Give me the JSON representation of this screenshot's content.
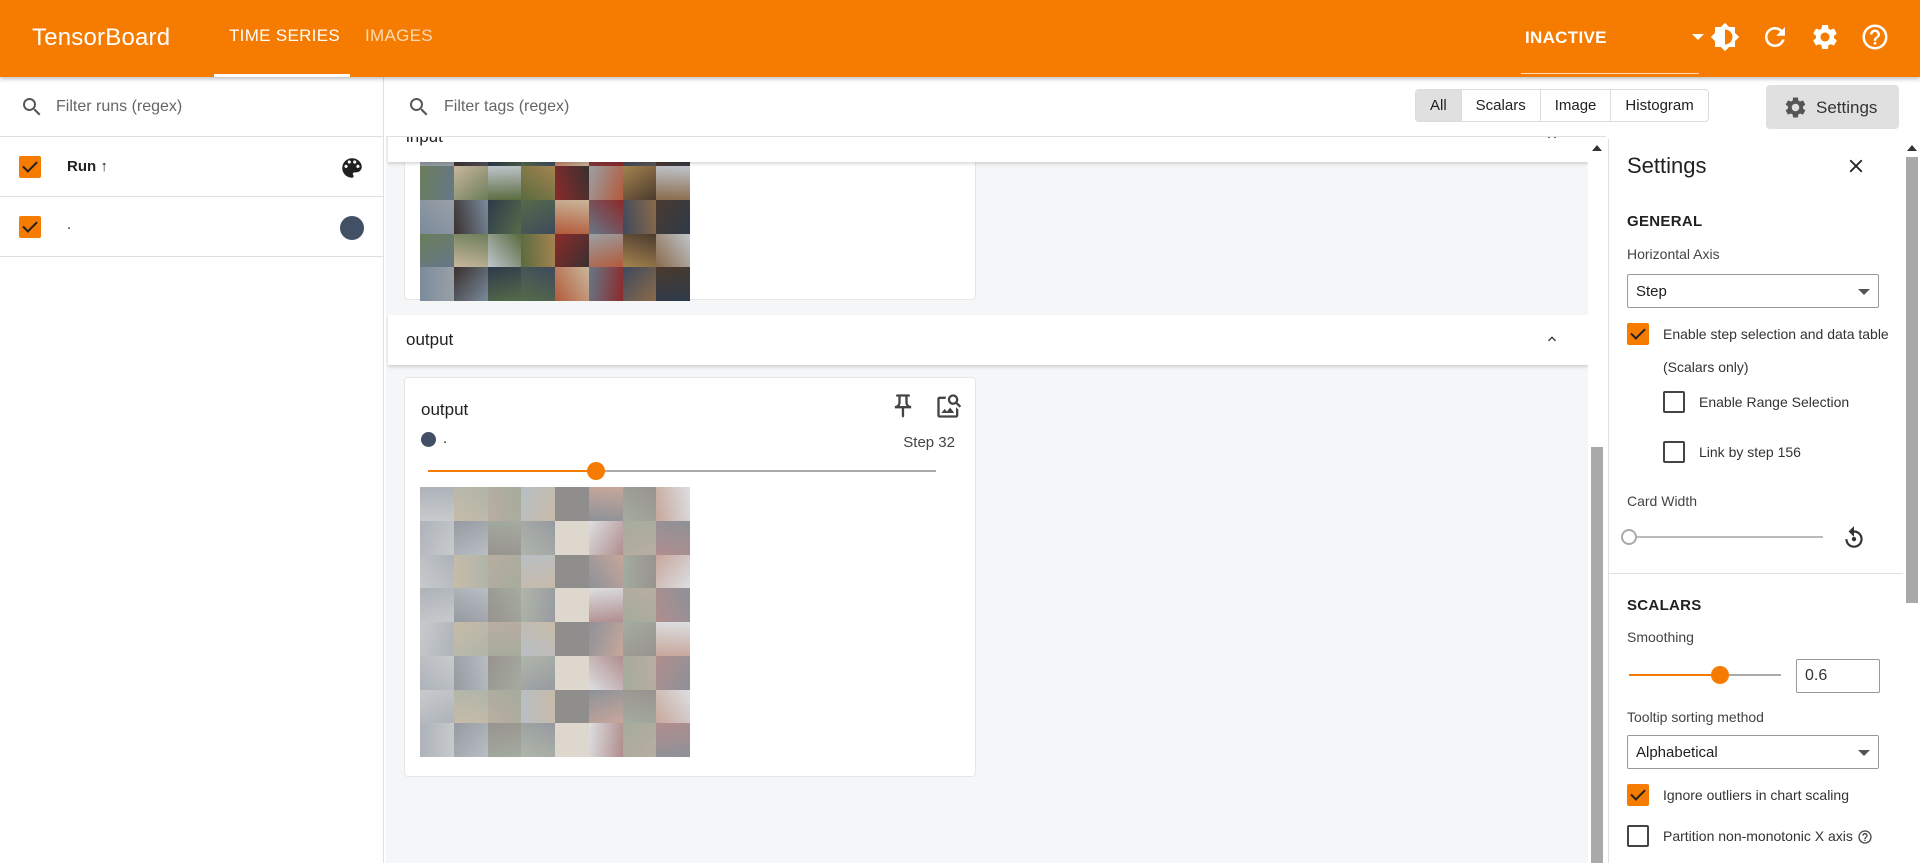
{
  "colors": {
    "accent": "#f57c00",
    "run_color": "#425066"
  },
  "topbar": {
    "brand": "TensorBoard",
    "tabs": [
      {
        "label": "TIME SERIES",
        "active": true
      },
      {
        "label": "IMAGES",
        "active": false
      }
    ],
    "status_select": "INACTIVE",
    "icons": [
      "dark-mode-icon",
      "refresh-icon",
      "settings-gear-icon",
      "help-icon"
    ]
  },
  "runs": {
    "filter_placeholder": "Filter runs (regex)",
    "header_label": "Run ↑",
    "items": [
      {
        "name": ".",
        "checked": true
      }
    ]
  },
  "main": {
    "filter_placeholder": "Filter tags (regex)",
    "type_filters": [
      "All",
      "Scalars",
      "Image",
      "Histogram"
    ],
    "settings_button": "Settings",
    "groups": [
      {
        "title": "input"
      },
      {
        "title": "output",
        "card": {
          "title": "output",
          "run_label": ".",
          "step_label": "Step 32",
          "slider_fraction": 0.33
        }
      }
    ]
  },
  "settings_panel": {
    "title": "Settings",
    "general": {
      "heading": "GENERAL",
      "horizontal_axis_label": "Horizontal Axis",
      "horizontal_axis_value": "Step",
      "step_selection_label": "Enable step selection and data table",
      "scalars_only_note": "(Scalars only)",
      "range_selection_label": "Enable Range Selection",
      "link_by_step_label": "Link by step 156",
      "card_width_label": "Card Width"
    },
    "scalars": {
      "heading": "SCALARS",
      "smoothing_label": "Smoothing",
      "smoothing_value": "0.6",
      "smoothing_fraction": 0.6,
      "tooltip_sort_label": "Tooltip sorting method",
      "tooltip_sort_value": "Alphabetical",
      "ignore_outliers_label": "Ignore outliers in chart scaling",
      "partition_label": "Partition non-monotonic X axis"
    }
  }
}
